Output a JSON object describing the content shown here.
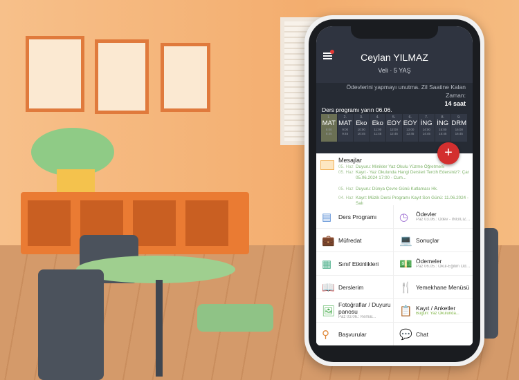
{
  "header": {
    "name": "Ceylan YILMAZ",
    "role": "Veli · 5 YAŞ"
  },
  "notice": {
    "text": "Ödevlerini yapmayı unutma. Zil Saatine Kalan Zaman:",
    "remaining": "14 saat"
  },
  "schedule": {
    "title": "Ders programı yarın 06.06.",
    "lessons": [
      {
        "n": "1.",
        "s": "MAT",
        "t1": "8:00",
        "t2": "8:45",
        "active": true
      },
      {
        "n": "2.",
        "s": "MAT",
        "t1": "9:00",
        "t2": "9:45"
      },
      {
        "n": "3.",
        "s": "Eko",
        "t1": "10:00",
        "t2": "10:45"
      },
      {
        "n": "4.",
        "s": "Eko",
        "t1": "11:00",
        "t2": "11:45"
      },
      {
        "n": "5.",
        "s": "EOY",
        "t1": "12:00",
        "t2": "12:45"
      },
      {
        "n": "6.",
        "s": "EOY",
        "t1": "13:00",
        "t2": "13:45"
      },
      {
        "n": "7.",
        "s": "İNG",
        "t1": "14:00",
        "t2": "14:45"
      },
      {
        "n": "8.",
        "s": "İNG",
        "t1": "15:00",
        "t2": "15:45"
      },
      {
        "n": "9.",
        "s": "DRM",
        "t1": "16:00",
        "t2": "16:45"
      }
    ]
  },
  "fab": "+",
  "messages": {
    "title": "Mesajlar",
    "items": [
      {
        "date": "05. Haz",
        "text": "Duyuru: Minikler Yaz Okulu Yüzme Öğretmeni"
      },
      {
        "date": "05. Haz",
        "text": "Kayıt - Yaz Okulunda Hangi Dersleri Tercih Edersiniz?: Çar 05.06.2024 17:00 - Cum..."
      },
      {
        "date": "05. Haz",
        "text": "Duyuru: Dünya Çevre Günü Kutlaması Hk."
      },
      {
        "date": "04. Haz",
        "text": "Kayıt: Müzik Dersi Programı Kayıt Son Günü: 11.06.2024 - Salı"
      }
    ]
  },
  "menu": [
    {
      "label": "Ders Programı",
      "icon": "notebook-icon",
      "glyph": "▤",
      "color": "#5b8fd6"
    },
    {
      "label": "Ödevler",
      "sub": "Paz 03.06.: Ödev - İNGİLİZCE - Five Sens...",
      "icon": "clock-icon",
      "glyph": "◷",
      "color": "#9b6bd1"
    },
    {
      "label": "Müfredat",
      "icon": "briefcase-icon",
      "glyph": "💼",
      "color": "#5b8fd6"
    },
    {
      "label": "Sonuçlar",
      "icon": "laptop-chart-icon",
      "glyph": "💻",
      "color": "#5b8fd6"
    },
    {
      "label": "Sınıf Etkinlikleri",
      "icon": "spreadsheet-icon",
      "glyph": "▦",
      "color": "#4caf8a"
    },
    {
      "label": "Ödemeler",
      "sub": "Paz 06.05.: Okul-Eğitim Ödemesi'e ait ücretler...",
      "icon": "money-hand-icon",
      "glyph": "💵",
      "color": "#4caf50"
    },
    {
      "label": "Derslerim",
      "icon": "book-icon",
      "glyph": "📖",
      "color": "#4cc1a0"
    },
    {
      "label": "Yemekhane Menüsü",
      "icon": "glass-fork-icon",
      "glyph": "🍴",
      "color": "#9b6bd1"
    },
    {
      "label": "Fotoğraflar / Duyuru panosu",
      "sub": "Paz 03.06.: Kemal...",
      "icon": "picture-icon",
      "glyph": "🖼",
      "color": "#4caf50"
    },
    {
      "label": "Kayıt / Anketler",
      "sub": "Bugün: Yaz Okulunda...",
      "subGreen": true,
      "icon": "clipboard-check-icon",
      "glyph": "📋",
      "color": "#e08a3c"
    },
    {
      "label": "Başvurular",
      "icon": "stamp-icon",
      "glyph": "⚲",
      "color": "#e08a3c"
    },
    {
      "label": "Chat",
      "icon": "chat-bubbles-icon",
      "glyph": "💬",
      "color": "#4caf50"
    }
  ]
}
